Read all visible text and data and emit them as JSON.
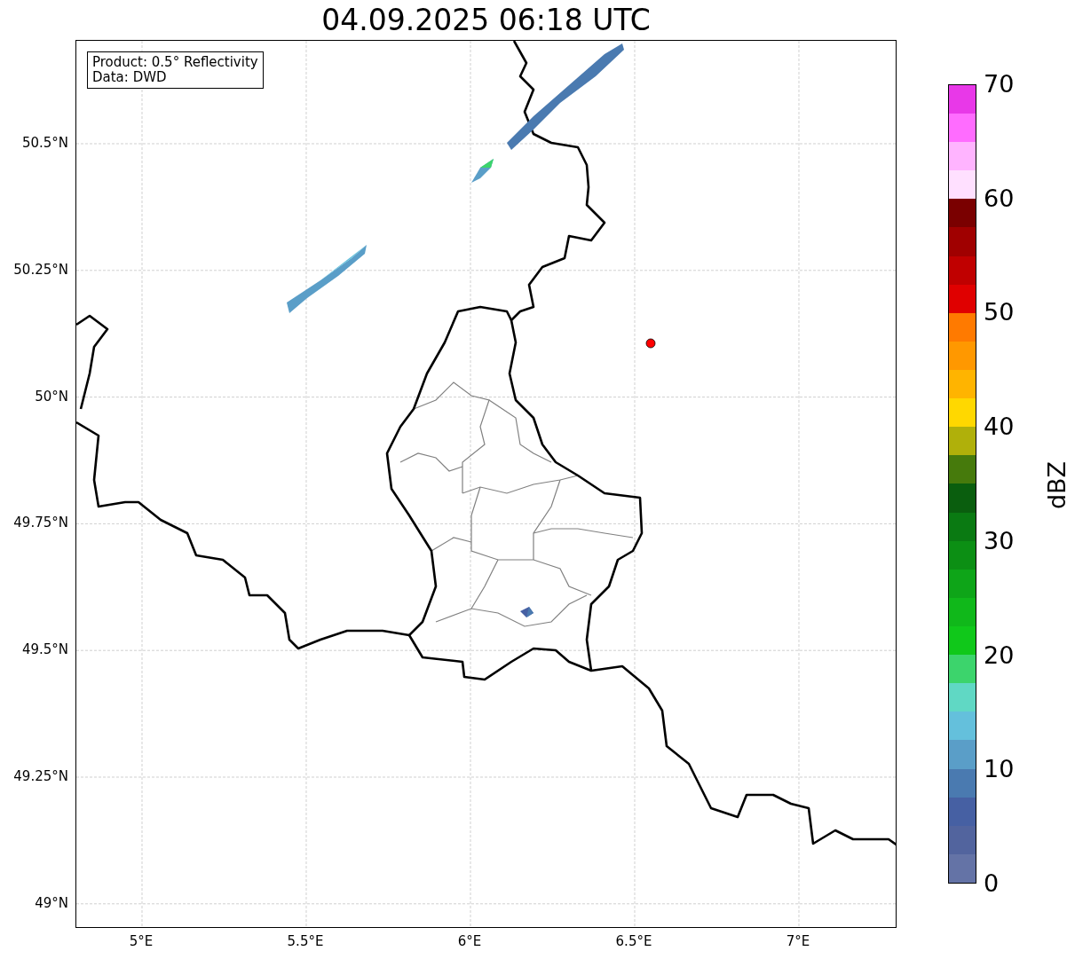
{
  "title": "04.09.2025 06:18 UTC",
  "info_box": {
    "lines": [
      "Product: 0.5° Reflectivity",
      "Data: DWD"
    ]
  },
  "y_ticks": [
    "50.5°N",
    "50.25°N",
    "50°N",
    "49.75°N",
    "49.5°N",
    "49.25°N",
    "49°N"
  ],
  "x_ticks": [
    "5°E",
    "5.5°E",
    "6°E",
    "6.5°E",
    "7°E"
  ],
  "colorbar": {
    "label": "dBZ",
    "tick_labels": [
      "70",
      "60",
      "50",
      "40",
      "30",
      "20",
      "10",
      "0"
    ],
    "bins": [
      {
        "color": "#6473a6"
      },
      {
        "color": "#52649e"
      },
      {
        "color": "#4660a3"
      },
      {
        "color": "#4a7ab0"
      },
      {
        "color": "#5a9ec8"
      },
      {
        "color": "#64c0dc"
      },
      {
        "color": "#60d8c4"
      },
      {
        "color": "#3cd46c"
      },
      {
        "color": "#10c81a"
      },
      {
        "color": "#10b81a"
      },
      {
        "color": "#0ea518"
      },
      {
        "color": "#0c8f14"
      },
      {
        "color": "#0a7a12"
      },
      {
        "color": "#0a5e0e"
      },
      {
        "color": "#467a0c"
      },
      {
        "color": "#b0b00a"
      },
      {
        "color": "#ffd800"
      },
      {
        "color": "#ffb400"
      },
      {
        "color": "#ff9800"
      },
      {
        "color": "#ff7a00"
      },
      {
        "color": "#e00000"
      },
      {
        "color": "#c00000"
      },
      {
        "color": "#a00000"
      },
      {
        "color": "#7a0000"
      },
      {
        "color": "#ffe0ff"
      },
      {
        "color": "#ffb4ff"
      },
      {
        "color": "#ff6cff"
      },
      {
        "color": "#e838e8"
      }
    ]
  }
}
